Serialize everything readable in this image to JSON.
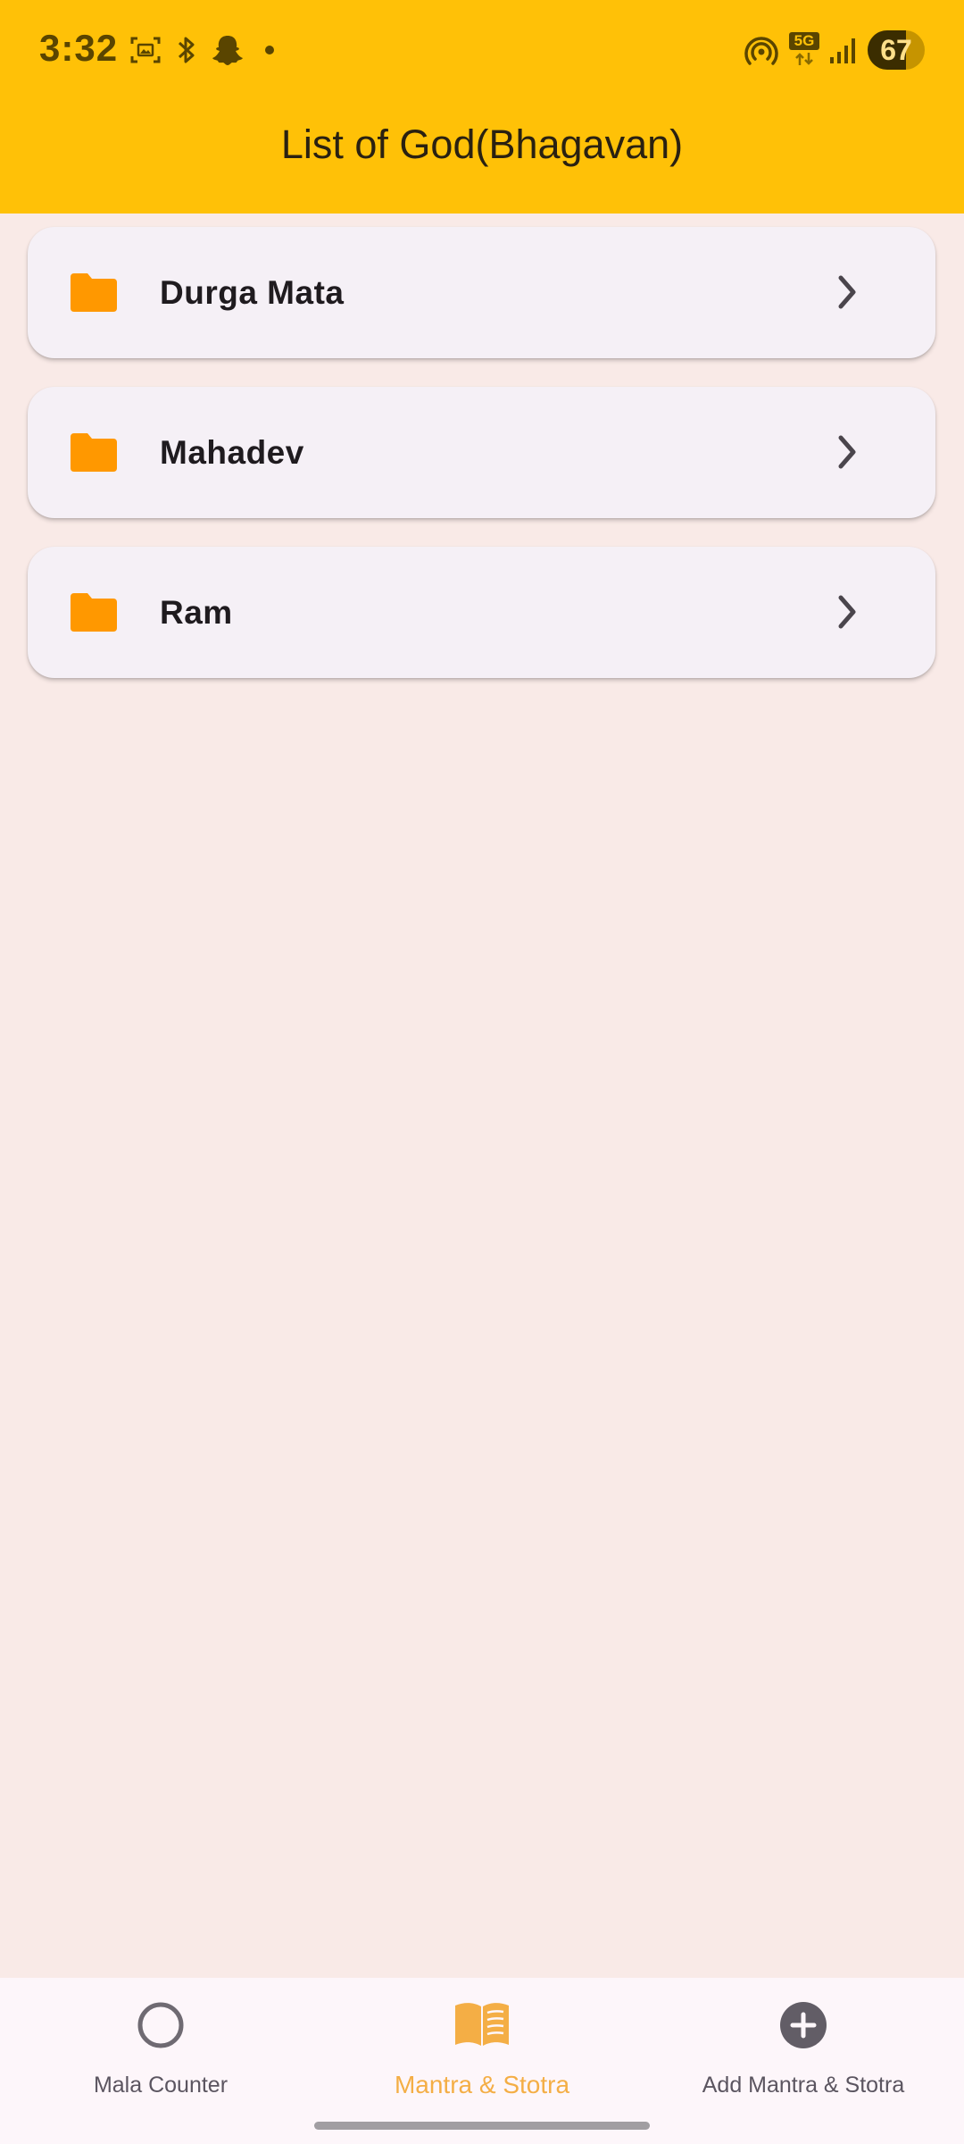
{
  "status_bar": {
    "time": "3:32",
    "battery_level": "67",
    "network_label": "5G",
    "icons": [
      "screenshot-icon",
      "bluetooth-icon",
      "snapchat-icon",
      "dot-icon",
      "hotspot-icon",
      "network-5g-icon",
      "signal-icon",
      "battery-icon"
    ]
  },
  "app_bar": {
    "title": "List of God(Bhagavan)"
  },
  "list": {
    "items": [
      {
        "label": "Durga Mata",
        "icon": "folder-icon",
        "trailing": "chevron-right-icon"
      },
      {
        "label": "Mahadev",
        "icon": "folder-icon",
        "trailing": "chevron-right-icon"
      },
      {
        "label": "Ram",
        "icon": "folder-icon",
        "trailing": "chevron-right-icon"
      }
    ]
  },
  "bottom_nav": {
    "items": [
      {
        "label": "Mala Counter",
        "icon": "circle-icon",
        "active": false
      },
      {
        "label": "Mantra & Stotra",
        "icon": "book-icon",
        "active": true
      },
      {
        "label": "Add Mantra & Stotra",
        "icon": "add-circle-icon",
        "active": false
      }
    ]
  },
  "colors": {
    "app_bar": "#FFC107",
    "background": "#F9EAE7",
    "card": "#F5F0F6",
    "folder": "#FF9800",
    "nav_active": "#F4AE45",
    "nav_inactive": "#5B5560"
  }
}
